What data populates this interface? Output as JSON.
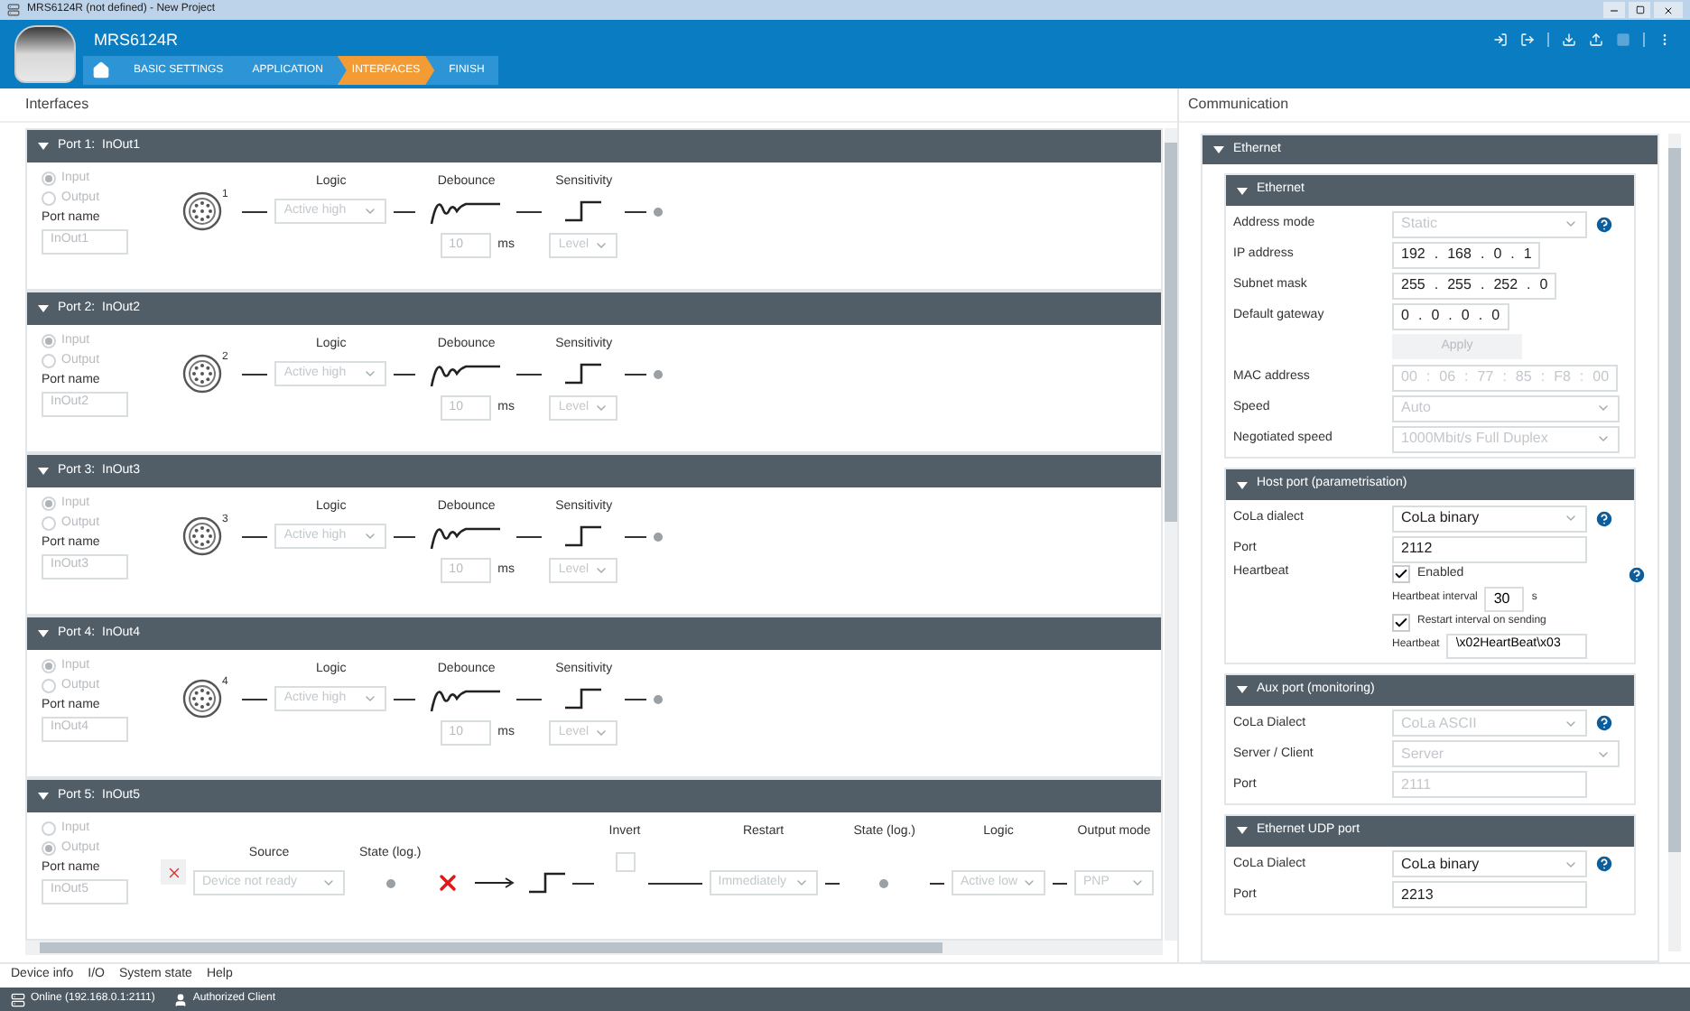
{
  "window": {
    "title": "MRS6124R (not defined) - New Project"
  },
  "header": {
    "device_name": "MRS6124R",
    "breadcrumbs": [
      {
        "label": "BASIC SETTINGS",
        "selected": false
      },
      {
        "label": "APPLICATION",
        "selected": false
      },
      {
        "label": "INTERFACES",
        "selected": true
      },
      {
        "label": "FINISH",
        "selected": false
      }
    ]
  },
  "interfaces": {
    "title": "Interfaces",
    "ports": [
      {
        "kind": "input",
        "title": "Port 1:  InOut1",
        "expanded": true,
        "options": [
          {
            "label": "Input",
            "selected": true
          },
          {
            "label": "Output",
            "selected": false
          }
        ],
        "port_name_label": "Port name",
        "port_name": "InOut1",
        "connector_number": "1",
        "logic_label": "Logic",
        "logic_value": "Active high",
        "debounce_label": "Debounce",
        "debounce_value": "10",
        "debounce_unit": "ms",
        "sensitivity_label": "Sensitivity",
        "sensitivity_value": "Level"
      },
      {
        "kind": "input",
        "title": "Port 2:  InOut2",
        "expanded": true,
        "options": [
          {
            "label": "Input",
            "selected": true
          },
          {
            "label": "Output",
            "selected": false
          }
        ],
        "port_name_label": "Port name",
        "port_name": "InOut2",
        "connector_number": "2",
        "logic_label": "Logic",
        "logic_value": "Active high",
        "debounce_label": "Debounce",
        "debounce_value": "10",
        "debounce_unit": "ms",
        "sensitivity_label": "Sensitivity",
        "sensitivity_value": "Level"
      },
      {
        "kind": "input",
        "title": "Port 3:  InOut3",
        "expanded": true,
        "options": [
          {
            "label": "Input",
            "selected": true
          },
          {
            "label": "Output",
            "selected": false
          }
        ],
        "port_name_label": "Port name",
        "port_name": "InOut3",
        "connector_number": "3",
        "logic_label": "Logic",
        "logic_value": "Active high",
        "debounce_label": "Debounce",
        "debounce_value": "10",
        "debounce_unit": "ms",
        "sensitivity_label": "Sensitivity",
        "sensitivity_value": "Level"
      },
      {
        "kind": "input",
        "title": "Port 4:  InOut4",
        "expanded": true,
        "options": [
          {
            "label": "Input",
            "selected": true
          },
          {
            "label": "Output",
            "selected": false
          }
        ],
        "port_name_label": "Port name",
        "port_name": "InOut4",
        "connector_number": "4",
        "logic_label": "Logic",
        "logic_value": "Active high",
        "debounce_label": "Debounce",
        "debounce_value": "10",
        "debounce_unit": "ms",
        "sensitivity_label": "Sensitivity",
        "sensitivity_value": "Level"
      },
      {
        "kind": "output",
        "title": "Port 5:  InOut5",
        "expanded": true,
        "options": [
          {
            "label": "Input",
            "selected": false
          },
          {
            "label": "Output",
            "selected": true
          }
        ],
        "port_name_label": "Port name",
        "port_name": "InOut5",
        "source_label": "Source",
        "source_value": "Device not ready",
        "state_label": "State (log.)",
        "invert_label": "Invert",
        "invert_checked": false,
        "restart_label": "Restart",
        "restart_value": "Immediately",
        "state2_label": "State (log.)",
        "logic_label": "Logic",
        "logic_value": "Active low",
        "output_mode_label": "Output mode",
        "output_mode_value": "PNP"
      }
    ]
  },
  "bottom_tabs": [
    "Device info",
    "I/O",
    "System state",
    "Help"
  ],
  "status_bar": {
    "connection": "Online (192.168.0.1:2111)",
    "user": "Authorized Client"
  },
  "communication": {
    "title": "Communication",
    "group": {
      "title": "Ethernet",
      "expanded": true,
      "sections": [
        {
          "title": "Ethernet",
          "expanded": true,
          "rows": [
            {
              "kind": "select",
              "label": "Address mode",
              "value": "Static",
              "disabled": true,
              "help": true
            },
            {
              "kind": "address",
              "label": "IP address",
              "parts": [
                "192",
                "168",
                "0",
                "1"
              ],
              "separator": ".",
              "disabled": false
            },
            {
              "kind": "address",
              "label": "Subnet mask",
              "parts": [
                "255",
                "255",
                "252",
                "0"
              ],
              "separator": ".",
              "disabled": false
            },
            {
              "kind": "address",
              "label": "Default gateway",
              "parts": [
                "0",
                "0",
                "0",
                "0"
              ],
              "separator": ".",
              "disabled": false
            },
            {
              "kind": "button",
              "value": "Apply",
              "disabled": true
            },
            {
              "kind": "address",
              "label": "MAC address",
              "parts": [
                "00",
                "06",
                "77",
                "85",
                "F8",
                "00"
              ],
              "separator": ":",
              "disabled": true
            },
            {
              "kind": "select",
              "label": "Speed",
              "value": "Auto",
              "disabled": true,
              "help": false
            },
            {
              "kind": "select",
              "label": "Negotiated speed",
              "value": "1000Mbit/s Full Duplex",
              "disabled": true,
              "help": false
            }
          ]
        },
        {
          "title": "Host port (parametrisation)",
          "expanded": true,
          "rows": [
            {
              "kind": "select",
              "label": "CoLa dialect",
              "value": "CoLa binary",
              "disabled": false,
              "help": true
            },
            {
              "kind": "text",
              "label": "Port",
              "value": "2112",
              "disabled": false
            },
            {
              "kind": "heartbeat",
              "label": "Heartbeat",
              "enabled": {
                "label": "Enabled",
                "checked": true
              },
              "interval_label": "Heartbeat interval",
              "interval": "30",
              "unit": "s",
              "restart": {
                "label": "Restart interval on sending",
                "checked": true
              },
              "message_label": "Heartbeat",
              "message": "\\x02HeartBeat\\x03",
              "help": true
            }
          ]
        },
        {
          "title": "Aux port (monitoring)",
          "expanded": true,
          "rows": [
            {
              "kind": "select",
              "label": "CoLa Dialect",
              "value": "CoLa ASCII",
              "disabled": true,
              "help": true
            },
            {
              "kind": "select",
              "label": "Server / Client",
              "value": "Server",
              "disabled": true,
              "help": false
            },
            {
              "kind": "text",
              "label": "Port",
              "value": "2111",
              "disabled": true
            }
          ]
        },
        {
          "title": "Ethernet UDP port",
          "expanded": true,
          "rows": [
            {
              "kind": "select",
              "label": "CoLa Dialect",
              "value": "CoLa binary",
              "disabled": false,
              "help": true
            },
            {
              "kind": "text",
              "label": "Port",
              "value": "2213",
              "disabled": false
            }
          ]
        }
      ]
    }
  }
}
